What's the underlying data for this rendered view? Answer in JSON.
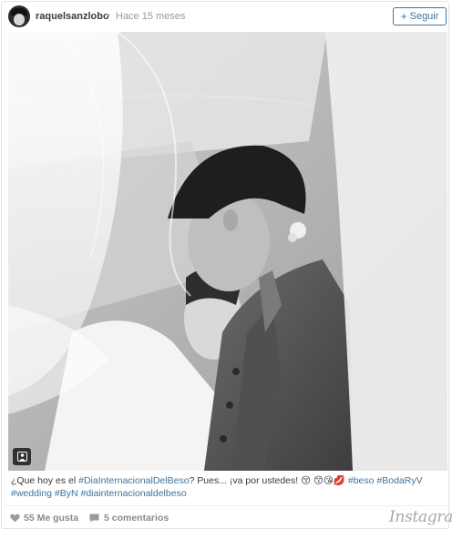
{
  "post": {
    "username": "raquelsanzlobo",
    "separator": "•",
    "time": "Hace 15 meses",
    "follow_label": "Seguir",
    "follow_icon": "plus-icon"
  },
  "caption": {
    "text_1": "¿Que hoy es el ",
    "hashtag_1": "#DiaInternacionalDelBeso",
    "text_2": "? Pues... ¡va por ustedes! ",
    "emojis": "😚 😙😘💋 ",
    "hashtags": [
      "#beso",
      "#BodaRyV",
      "#wedding",
      "#ByN",
      "#diainternacionaldelbeso"
    ]
  },
  "footer": {
    "likes": "55 Me gusta",
    "comments": "5 comentarios",
    "brand": "Instagram"
  },
  "colors": {
    "link": "#3f729b",
    "text": "#3a3a3a",
    "muted": "#8a8a8a"
  }
}
